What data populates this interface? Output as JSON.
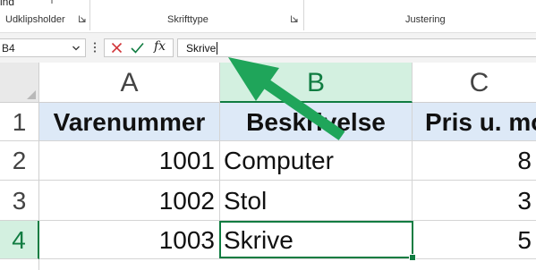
{
  "ribbon": {
    "top_partial_text": "ind",
    "groups": [
      {
        "label": "Udklipsholder"
      },
      {
        "label": "Skrifttype"
      },
      {
        "label": "Justering"
      }
    ]
  },
  "formula_bar": {
    "name_box": "B4",
    "fx_label": "fx",
    "formula": "Skrive"
  },
  "columns": [
    {
      "letter": "A",
      "selected": false
    },
    {
      "letter": "B",
      "selected": true
    },
    {
      "letter": "C",
      "selected": false
    }
  ],
  "rows": [
    {
      "number": "1",
      "selected": false,
      "cells": [
        "Varenummer",
        "Beskrivelse",
        "Pris u. mo"
      ]
    },
    {
      "number": "2",
      "selected": false,
      "cells": [
        "1001",
        "Computer",
        "8"
      ]
    },
    {
      "number": "3",
      "selected": false,
      "cells": [
        "1002",
        "Stol",
        "3"
      ]
    },
    {
      "number": "4",
      "selected": true,
      "cells": [
        "1003",
        "Skrive",
        "5"
      ]
    }
  ],
  "colors": {
    "accent_green": "#107c41",
    "selected_header_bg": "#d3f0e0",
    "header_row_bg": "#dde9f7",
    "annotation_arrow": "#1fa55a"
  },
  "icons": {
    "cancel": "x-cancel-icon",
    "enter": "checkmark-enter-icon",
    "insert_function": "fx-icon",
    "name_box_dropdown": "chevron-down-icon",
    "format_painter": "format-painter-icon",
    "dialog_launcher": "dialog-launcher-icon"
  }
}
